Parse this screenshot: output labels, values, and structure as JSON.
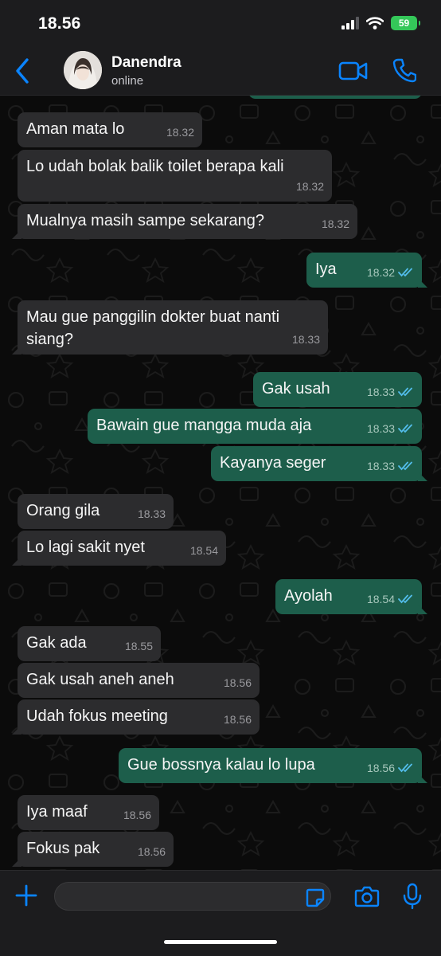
{
  "status_bar": {
    "time": "18.56",
    "battery": "59"
  },
  "header": {
    "contact_name": "Danendra",
    "contact_status": "online"
  },
  "messages": [
    {
      "text": "Aman mata lo",
      "time": "18.32"
    },
    {
      "text": "Lo udah bolak balik toilet berapa kali",
      "time": "18.32"
    },
    {
      "text": "Mualnya masih sampe sekarang?",
      "time": "18.32"
    },
    {
      "text": "Iya",
      "time": "18.32"
    },
    {
      "text": "Mau gue panggilin dokter buat nanti siang?",
      "time": "18.33"
    },
    {
      "text": "Gak usah",
      "time": "18.33"
    },
    {
      "text": "Bawain gue mangga muda aja",
      "time": "18.33"
    },
    {
      "text": "Kayanya seger",
      "time": "18.33"
    },
    {
      "text": "Orang gila",
      "time": "18.33"
    },
    {
      "text": "Lo lagi sakit nyet",
      "time": "18.54"
    },
    {
      "text": "Ayolah",
      "time": "18.54"
    },
    {
      "text": "Gak ada",
      "time": "18.55"
    },
    {
      "text": "Gak usah aneh aneh",
      "time": "18.56"
    },
    {
      "text": "Udah fokus meeting",
      "time": "18.56"
    },
    {
      "text": "Gue bossnya kalau lo lupa",
      "time": "18.56"
    },
    {
      "text": "Iya maaf",
      "time": "18.56"
    },
    {
      "text": "Fokus pak",
      "time": "18.56"
    }
  ],
  "composer": {
    "placeholder": ""
  },
  "colors": {
    "accent": "#0a84ff",
    "incoming_bubble": "#2c2c2e",
    "outgoing_bubble": "#1d5e4b",
    "read_ticks": "#53bdeb",
    "battery": "#34c759"
  }
}
